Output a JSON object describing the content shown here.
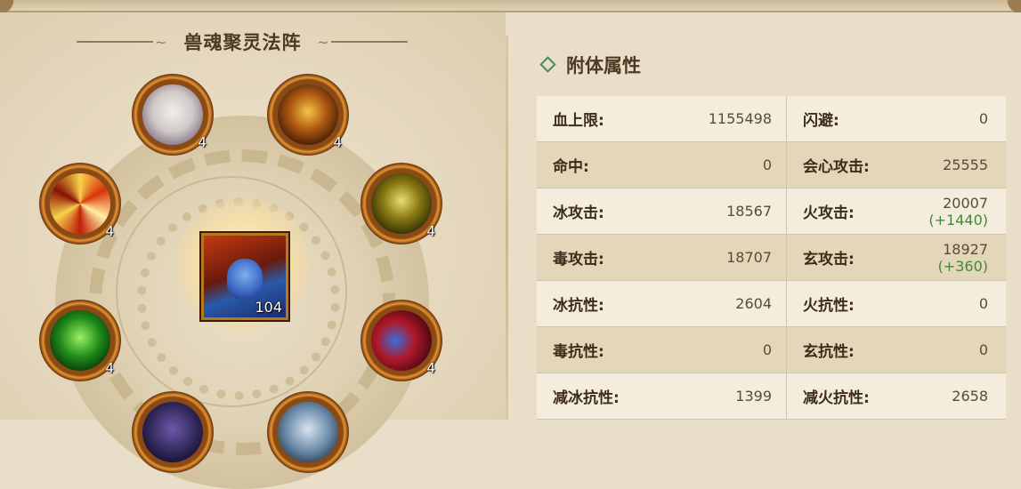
{
  "array": {
    "title": "兽魂聚灵法阵",
    "center": {
      "level": "104"
    },
    "slots": [
      {
        "name": "beast-slot-1",
        "level": "4"
      },
      {
        "name": "beast-slot-2",
        "level": "4"
      },
      {
        "name": "beast-slot-3",
        "level": "4"
      },
      {
        "name": "beast-slot-4",
        "level": "4"
      },
      {
        "name": "beast-slot-5",
        "level": "4"
      },
      {
        "name": "beast-slot-6",
        "level": "4"
      },
      {
        "name": "beast-slot-7",
        "level": ""
      },
      {
        "name": "beast-slot-8",
        "level": ""
      }
    ]
  },
  "attributes": {
    "title": "附体属性",
    "rows": [
      {
        "l1": "血上限:",
        "v1": "1155498",
        "l2": "闪避:",
        "v2": "0",
        "b2": ""
      },
      {
        "l1": "命中:",
        "v1": "0",
        "l2": "会心攻击:",
        "v2": "25555",
        "b2": ""
      },
      {
        "l1": "冰攻击:",
        "v1": "18567",
        "l2": "火攻击:",
        "v2": "20007",
        "b2": "(+1440)"
      },
      {
        "l1": "毒攻击:",
        "v1": "18707",
        "l2": "玄攻击:",
        "v2": "18927",
        "b2": "(+360)"
      },
      {
        "l1": "冰抗性:",
        "v1": "2604",
        "l2": "火抗性:",
        "v2": "0",
        "b2": ""
      },
      {
        "l1": "毒抗性:",
        "v1": "0",
        "l2": "玄抗性:",
        "v2": "0",
        "b2": ""
      },
      {
        "l1": "减冰抗性:",
        "v1": "1399",
        "l2": "减火抗性:",
        "v2": "2658",
        "b2": ""
      }
    ]
  },
  "colors": {
    "accent_green": "#3e8a3a",
    "title_brown": "#4e3a24"
  }
}
